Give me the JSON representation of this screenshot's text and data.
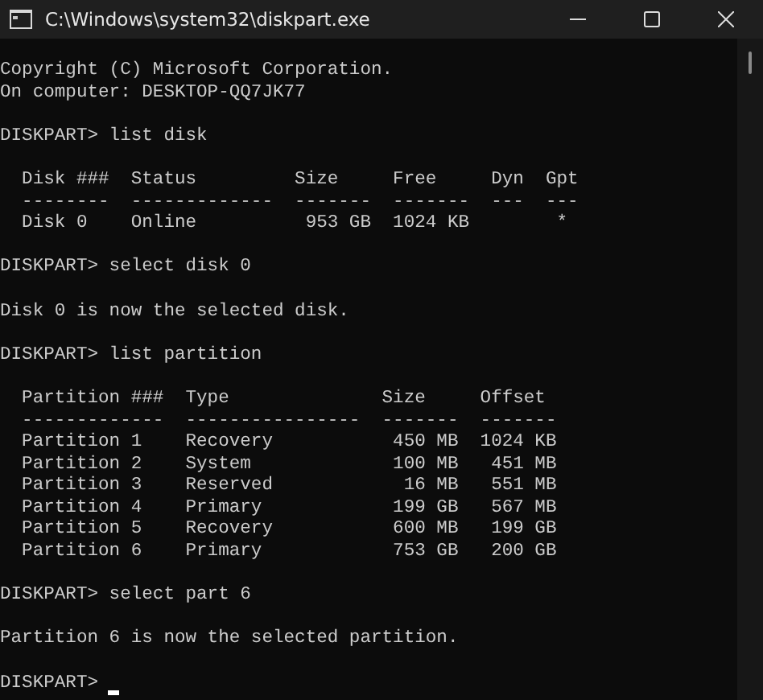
{
  "window": {
    "title": "C:\\Windows\\system32\\diskpart.exe",
    "controls": [
      {
        "kind": "minimize"
      },
      {
        "kind": "maximize"
      },
      {
        "kind": "close"
      }
    ]
  },
  "console_lines": [
    {
      "kind": "output",
      "text": "Copyright (C) Microsoft Corporation."
    },
    {
      "kind": "output",
      "text": "On computer: DESKTOP-QQ7JK77"
    },
    {
      "kind": "blank"
    },
    {
      "kind": "prompt",
      "text": "DISKPART> list disk"
    },
    {
      "kind": "blank"
    },
    {
      "kind": "output",
      "text": "  Disk ###  Status         Size     Free     Dyn  Gpt"
    },
    {
      "kind": "output",
      "text": "  --------  -------------  -------  -------  ---  ---"
    },
    {
      "kind": "output",
      "text": "  Disk 0    Online          953 GB  1024 KB        *"
    },
    {
      "kind": "blank"
    },
    {
      "kind": "prompt",
      "text": "DISKPART> select disk 0"
    },
    {
      "kind": "blank"
    },
    {
      "kind": "output",
      "text": "Disk 0 is now the selected disk."
    },
    {
      "kind": "blank"
    },
    {
      "kind": "prompt",
      "text": "DISKPART> list partition"
    },
    {
      "kind": "blank"
    },
    {
      "kind": "output",
      "text": "  Partition ###  Type              Size     Offset"
    },
    {
      "kind": "output",
      "text": "  -------------  ----------------  -------  -------"
    },
    {
      "kind": "output",
      "text": "  Partition 1    Recovery           450 MB  1024 KB"
    },
    {
      "kind": "output",
      "text": "  Partition 2    System             100 MB   451 MB"
    },
    {
      "kind": "output",
      "text": "  Partition 3    Reserved            16 MB   551 MB"
    },
    {
      "kind": "output",
      "text": "  Partition 4    Primary            199 GB   567 MB"
    },
    {
      "kind": "output",
      "text": "  Partition 5    Recovery           600 MB   199 GB"
    },
    {
      "kind": "output",
      "text": "  Partition 6    Primary            753 GB   200 GB"
    },
    {
      "kind": "blank"
    },
    {
      "kind": "prompt",
      "text": "DISKPART> select part 6"
    },
    {
      "kind": "blank"
    },
    {
      "kind": "output",
      "text": "Partition 6 is now the selected partition."
    },
    {
      "kind": "blank"
    },
    {
      "kind": "prompt",
      "text": "DISKPART>",
      "cursor": true
    }
  ]
}
